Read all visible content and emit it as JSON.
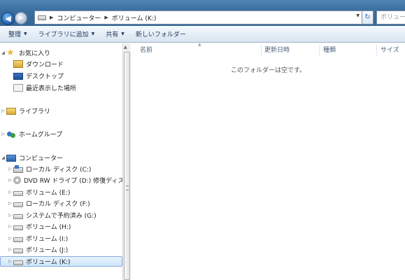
{
  "address": {
    "crumbs": [
      "コンピューター",
      "ボリューム (K:)"
    ],
    "search_placeholder": "ボリュー..."
  },
  "toolbar": {
    "organize": "整理",
    "include_library": "ライブラリに追加",
    "share": "共有",
    "new_folder": "新しいフォルダー"
  },
  "nav": {
    "favorites": {
      "label": "お気に入り",
      "items": [
        "ダウンロード",
        "デスクトップ",
        "最近表示した場所"
      ]
    },
    "libraries": "ライブラリ",
    "homegroup": "ホームグループ",
    "computer": {
      "label": "コンピューター",
      "drives": [
        "ローカル ディスク (C:)",
        "DVD RW ドライブ (D:) 修復ディスク",
        "ボリューム (E:)",
        "ローカル ディスク (F:)",
        "システムで予約済み (G:)",
        "ボリューム (H:)",
        "ボリューム (I:)",
        "ボリューム (J:)",
        "ボリューム (K:)"
      ],
      "selected": "ボリューム (K:)"
    }
  },
  "content": {
    "columns": [
      "名前",
      "更新日時",
      "種類",
      "サイズ"
    ],
    "empty_message": "このフォルダーは空です。"
  }
}
